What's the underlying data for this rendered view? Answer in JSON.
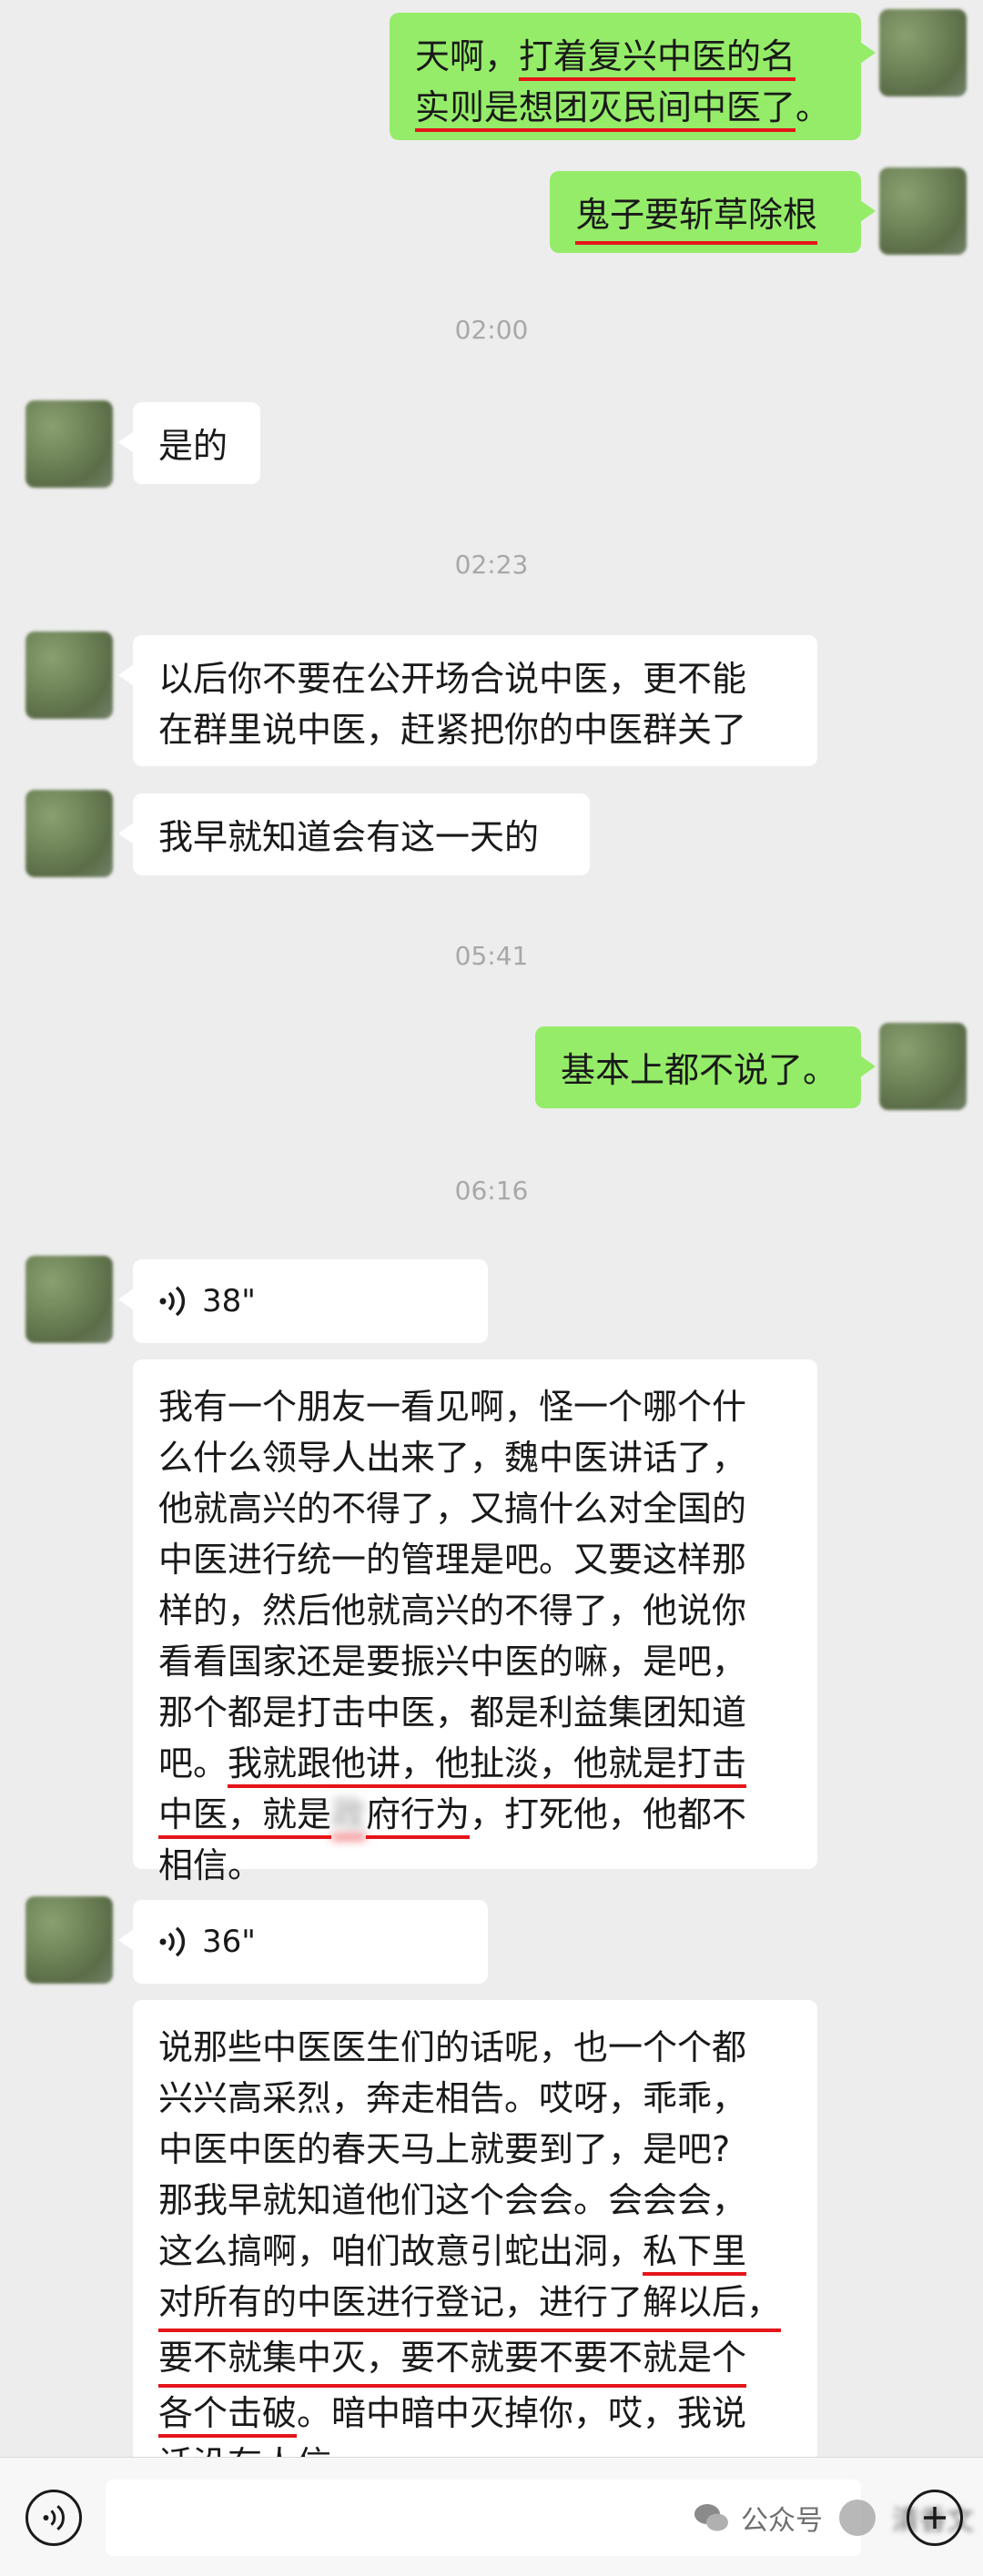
{
  "messages": {
    "m1": {
      "l1a": "天啊，",
      "l1b": "打着复兴中医的名",
      "l2a": "实则是想团灭民间中医了",
      "l2b": "。"
    },
    "m2": {
      "text": "鬼子要斩草除根"
    },
    "t1": "02:00",
    "m3": {
      "text": "是的"
    },
    "t2": "02:23",
    "m4": {
      "l1": "以后你不要在公开场合说中医，更不能",
      "l2": "在群里说中医，赶紧把你的中医群关了"
    },
    "m5": {
      "text": "我早就知道会有这一天的"
    },
    "t3": "05:41",
    "m6": {
      "text": "基本上都不说了。"
    },
    "t4": "06:16",
    "v1": {
      "duration": "38\""
    },
    "m7": {
      "l1": "我有一个朋友一看见啊，怪一个哪个什",
      "l2": "么什么领导人出来了，魏中医讲话了，",
      "l3": "他就高兴的不得了，又搞什么对全国的",
      "l4": "中医进行统一的管理是吧。又要这样那",
      "l5": "样的，然后他就高兴的不得了，他说你",
      "l6": "看看国家还是要振兴中医的嘛，是吧，",
      "l7": "那个都是打击中医，都是利益集团知道",
      "l8a": "吧。",
      "l8b": "我就跟他讲，他扯淡，他就是打击",
      "l9a": "中医，就是",
      "l9blur": "政",
      "l9b": "府行为",
      "l9c": "，打死他，他都不",
      "l10": "相信。"
    },
    "v2": {
      "duration": "36\""
    },
    "m8": {
      "l1": "说那些中医医生们的话呢，也一个个都",
      "l2": "兴兴高采烈，奔走相告。哎呀，乖乖，",
      "l3": "中医中医的春天马上就要到了，是吧?",
      "l4": "那我早就知道他们这个会会。会会会，",
      "l5a": "这么搞啊，咱们故意引蛇出洞，",
      "l5b": "私下里",
      "l6": "对所有的中医进行登记，进行了解以后，",
      "l7": "要不就集中灭，要不就要不要不就是个",
      "l8a": "各个击破",
      "l8b": "。暗中暗中灭掉你，哎，我说",
      "l9": "话没有人信。"
    }
  },
  "watermark": {
    "left": "公众号",
    "right": "清香文"
  }
}
